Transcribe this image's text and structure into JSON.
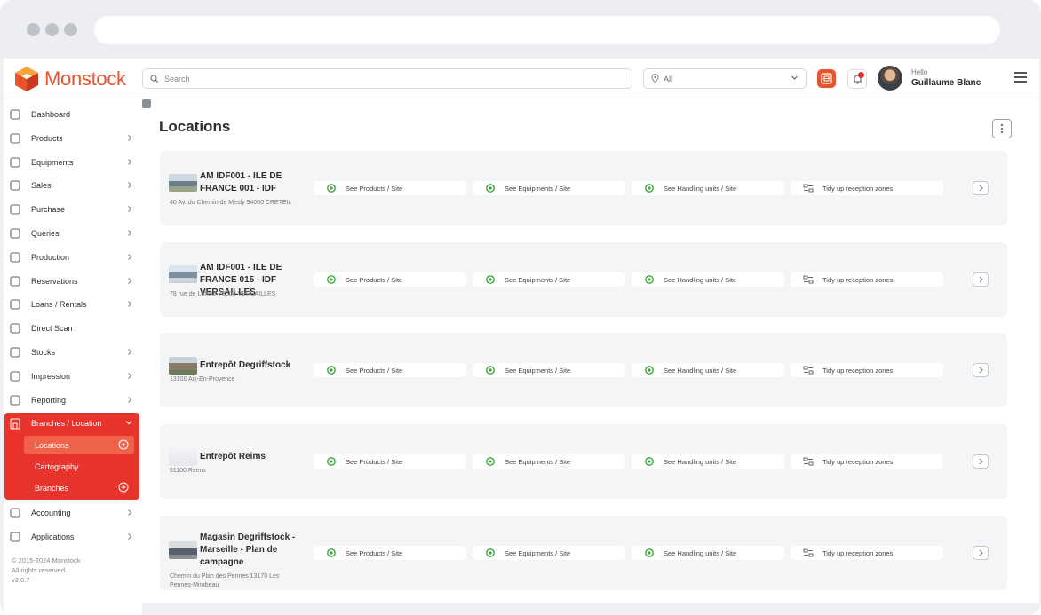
{
  "brand": {
    "name": "Monstock",
    "color": "#e8542c"
  },
  "search": {
    "placeholder": "Search"
  },
  "filter": {
    "value": "All"
  },
  "user": {
    "greeting": "Hello",
    "name": "Guillaume Blanc"
  },
  "sidebar": {
    "items": [
      {
        "label": "Dashboard",
        "icon": "grid-icon",
        "has_arrow": false
      },
      {
        "label": "Products",
        "icon": "box-icon",
        "has_arrow": true
      },
      {
        "label": "Equipments",
        "icon": "tool-icon",
        "has_arrow": true
      },
      {
        "label": "Sales",
        "icon": "shop-icon",
        "has_arrow": true
      },
      {
        "label": "Purchase",
        "icon": "cart-icon",
        "has_arrow": true
      },
      {
        "label": "Queries",
        "icon": "chat-icon",
        "has_arrow": true
      },
      {
        "label": "Production",
        "icon": "hammer-icon",
        "has_arrow": true
      },
      {
        "label": "Reservations",
        "icon": "calendar-icon",
        "has_arrow": true
      },
      {
        "label": "Loans / Rentals",
        "icon": "pin-icon",
        "has_arrow": true
      },
      {
        "label": "Direct Scan",
        "icon": "scan-icon",
        "has_arrow": false
      },
      {
        "label": "Stocks",
        "icon": "warehouse-icon",
        "has_arrow": true
      },
      {
        "label": "Impression",
        "icon": "tag-icon",
        "has_arrow": true
      },
      {
        "label": "Reporting",
        "icon": "report-icon",
        "has_arrow": true
      }
    ],
    "active_group": {
      "label": "Branches / Location",
      "subitems": [
        {
          "label": "Locations",
          "active": true,
          "has_plus": true
        },
        {
          "label": "Cartography",
          "active": false,
          "has_plus": false
        },
        {
          "label": "Branches",
          "active": false,
          "has_plus": true
        }
      ]
    },
    "bottom_items": [
      {
        "label": "Accounting",
        "icon": "calc-icon",
        "has_arrow": true
      },
      {
        "label": "Applications",
        "icon": "clipboard-icon",
        "has_arrow": true
      }
    ],
    "footer": {
      "line1": "© 2015-2024 Monstock",
      "line2": "All rights reserved.",
      "line3": "v2.0.7"
    }
  },
  "main": {
    "title": "Locations",
    "actions": {
      "products": "See Products / Site",
      "equipments": "See Equipments / Site",
      "handling": "See Handling units / Site",
      "tidy": "Tidy up reception zones"
    },
    "locations": [
      {
        "title": "AM IDF001 - ILE DE FRANCE 001 - IDF",
        "address": "40 Av. du Chemin de Mesly 94000 CRETEIL"
      },
      {
        "title": "AM IDF001 - ILE DE FRANCE 015 - IDF VERSAILLES",
        "address": "78 rue de Laffeur 78000 VERSAILLES"
      },
      {
        "title": "Entrepôt Degriffstock",
        "address": "13100 Aix-En-Provence"
      },
      {
        "title": "Entrepôt Reims",
        "address": "51100 Reims"
      },
      {
        "title": "Magasin Degriffstock - Marseille - Plan de campagne",
        "address": "Chemin du Plan des Pennes 13170 Les Pennes-Mirabeau"
      }
    ]
  },
  "colors": {
    "accent": "#e8342c",
    "eye": "#3aa63a",
    "card_bg": "#f4f5f7"
  }
}
